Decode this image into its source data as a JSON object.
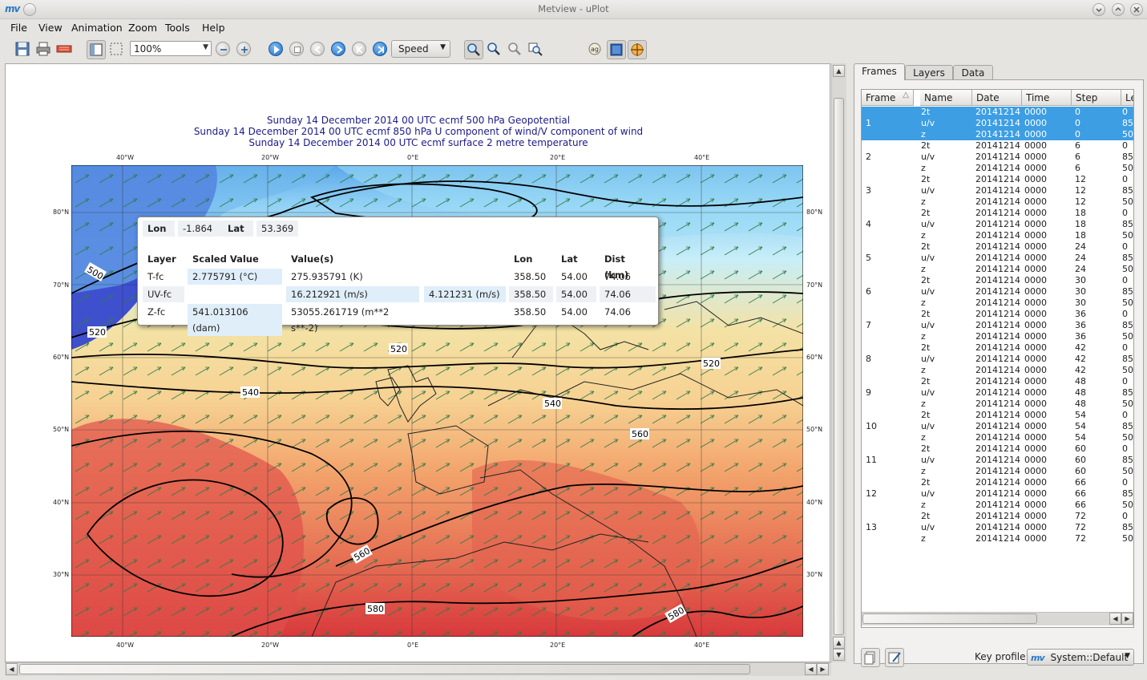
{
  "window": {
    "title": "Metview - uPlot"
  },
  "menu": [
    "File",
    "View",
    "Animation",
    "Zoom",
    "Tools",
    "Help"
  ],
  "toolbar": {
    "zoom_value": "100%",
    "speed_label": "Speed"
  },
  "plot": {
    "titles": [
      "Sunday 14 December 2014 00 UTC ecmf 500 hPa  Geopotential",
      "Sunday 14 December 2014 00 UTC ecmf 850 hPa  U component of wind/V component of wind",
      "Sunday 14 December 2014 00 UTC ecmf surface  2 metre temperature"
    ],
    "lon_labels": [
      "40°W",
      "20°W",
      "0°E",
      "20°E",
      "40°E"
    ],
    "lat_labels": [
      "80°N",
      "70°N",
      "60°N",
      "50°N",
      "40°N",
      "30°N"
    ],
    "contour_labels": [
      "500",
      "520",
      "520",
      "520",
      "540",
      "540",
      "560",
      "560",
      "580",
      "580"
    ]
  },
  "cursor_data": {
    "lon_label": "Lon",
    "lon_value": "-1.864",
    "lat_label": "Lat",
    "lat_value": "53.369",
    "headers": [
      "Layer",
      "Scaled Value",
      "Value(s)",
      "Lon",
      "Lat",
      "Dist (km)"
    ],
    "rows": [
      {
        "layer": "T-fc",
        "scaled": "2.775791 (°C)",
        "value1": "275.935791 (K)",
        "value2": "",
        "lon": "358.50",
        "lat": "54.00",
        "dist": "74.06"
      },
      {
        "layer": "UV-fc",
        "scaled": "",
        "value1": "16.212921 (m/s)",
        "value2": "4.121231 (m/s)",
        "lon": "358.50",
        "lat": "54.00",
        "dist": "74.06"
      },
      {
        "layer": "Z-fc",
        "scaled": "541.013106 (dam)",
        "value1": "53055.261719 (m**2 s**-2)",
        "value2": "",
        "lon": "358.50",
        "lat": "54.00",
        "dist": "74.06"
      }
    ]
  },
  "panel": {
    "tabs": [
      "Frames",
      "Layers",
      "Data"
    ],
    "columns": [
      "Frame",
      "Name",
      "Date",
      "Time",
      "Step",
      "Le"
    ],
    "frames": [
      {
        "frame": "1",
        "step": "0",
        "selected": true
      },
      {
        "frame": "2",
        "step": "6"
      },
      {
        "frame": "3",
        "step": "12"
      },
      {
        "frame": "4",
        "step": "18"
      },
      {
        "frame": "5",
        "step": "24"
      },
      {
        "frame": "6",
        "step": "30"
      },
      {
        "frame": "7",
        "step": "36"
      },
      {
        "frame": "8",
        "step": "42"
      },
      {
        "frame": "9",
        "step": "48"
      },
      {
        "frame": "10",
        "step": "54"
      },
      {
        "frame": "11",
        "step": "60"
      },
      {
        "frame": "12",
        "step": "66"
      },
      {
        "frame": "13",
        "step": "72"
      }
    ],
    "layer_names": [
      "2t",
      "u/v",
      "z"
    ],
    "layer_levels": [
      "0",
      "85",
      "50"
    ],
    "date": "20141214",
    "time": "0000",
    "key_profile_label": "Key profile:",
    "key_profile_value": "System::Default"
  },
  "colors": {
    "selection": "#3d9ee3",
    "title_text": "#1b1b88",
    "accent": "#2a78c8"
  }
}
